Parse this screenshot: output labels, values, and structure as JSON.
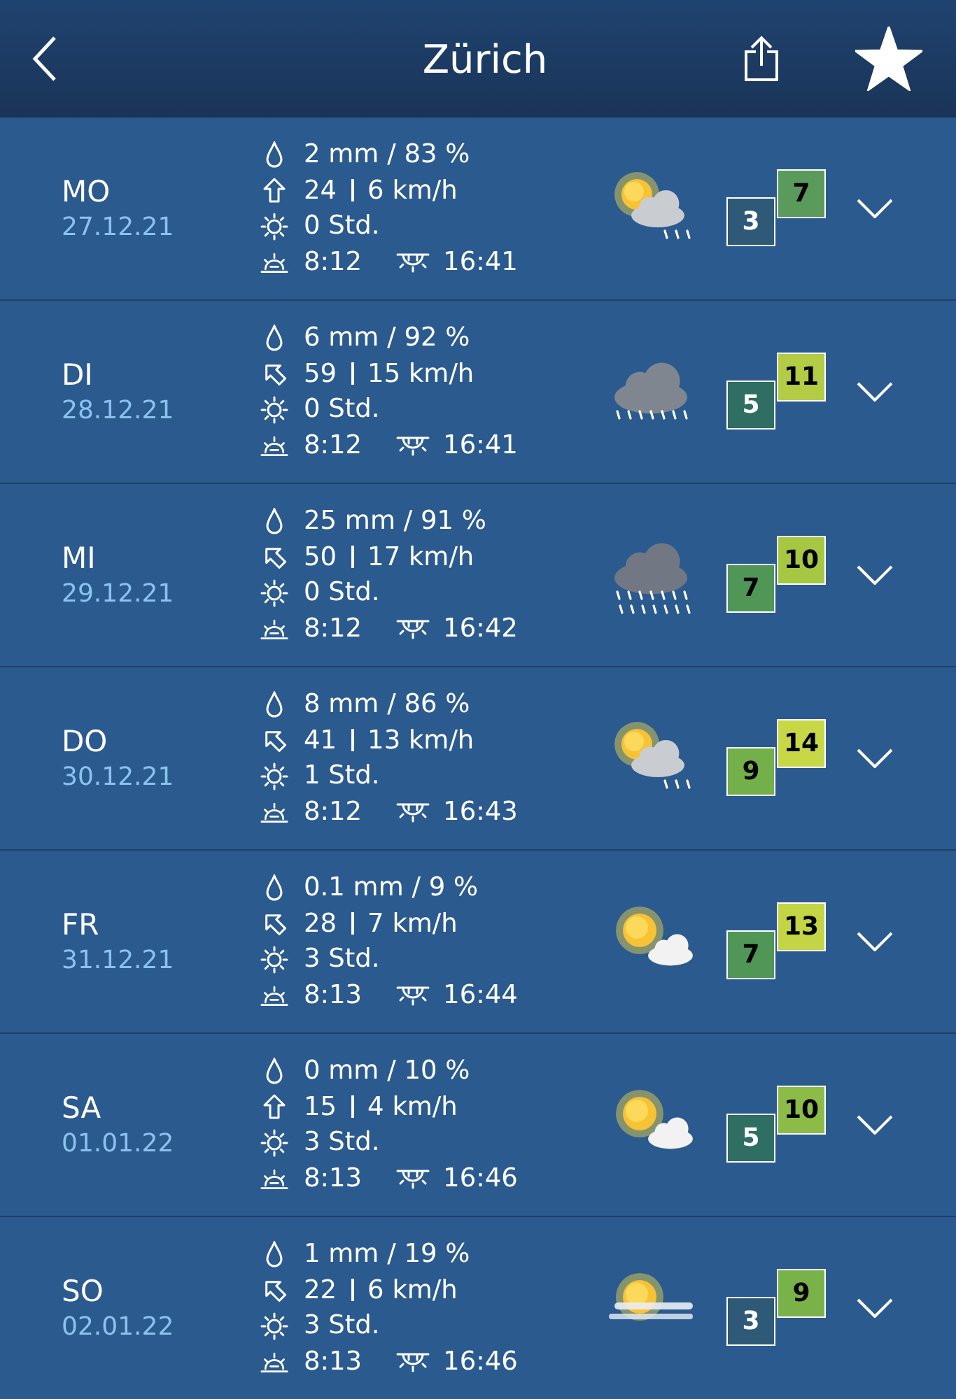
{
  "header": {
    "title": "Zürich",
    "favorite": true
  },
  "days": [
    {
      "day": "MO",
      "date": "27.12.21",
      "precipitation": "2 mm / 83 %",
      "wind": {
        "kind": "up",
        "a": "24",
        "b": "6 km/h"
      },
      "sunshine": "0 Std.",
      "sunrise": "8:12",
      "sunset": "16:41",
      "weather": {
        "kind": "sun_cloud_rain"
      },
      "temp_min": {
        "value": "3",
        "color": "#2e5a78"
      },
      "temp_max": {
        "value": "7",
        "color": "#5a9a5a"
      }
    },
    {
      "day": "DI",
      "date": "28.12.21",
      "precipitation": "6 mm / 92 %",
      "wind": {
        "kind": "up_left",
        "a": "59",
        "b": "15 km/h"
      },
      "sunshine": "0 Std.",
      "sunrise": "8:12",
      "sunset": "16:41",
      "weather": {
        "kind": "rain"
      },
      "temp_min": {
        "value": "5",
        "color": "#2f6e62"
      },
      "temp_max": {
        "value": "11",
        "color": "#b3cb45"
      }
    },
    {
      "day": "MI",
      "date": "29.12.21",
      "precipitation": "25 mm / 91 %",
      "wind": {
        "kind": "up_left",
        "a": "50",
        "b": "17 km/h"
      },
      "sunshine": "0 Std.",
      "sunrise": "8:12",
      "sunset": "16:42",
      "weather": {
        "kind": "heavy_rain"
      },
      "temp_min": {
        "value": "7",
        "color": "#4f9657"
      },
      "temp_max": {
        "value": "10",
        "color": "#a6c742"
      }
    },
    {
      "day": "DO",
      "date": "30.12.21",
      "precipitation": "8 mm / 86 %",
      "wind": {
        "kind": "up_left",
        "a": "41",
        "b": "13 km/h"
      },
      "sunshine": "1 Std.",
      "sunrise": "8:12",
      "sunset": "16:43",
      "weather": {
        "kind": "sun_cloud_rain"
      },
      "temp_min": {
        "value": "9",
        "color": "#73b04a"
      },
      "temp_max": {
        "value": "14",
        "color": "#c8d746"
      }
    },
    {
      "day": "FR",
      "date": "31.12.21",
      "precipitation": "0.1 mm / 9 %",
      "wind": {
        "kind": "up_left",
        "a": "28",
        "b": "7 km/h"
      },
      "sunshine": "3 Std.",
      "sunrise": "8:13",
      "sunset": "16:44",
      "weather": {
        "kind": "sun_cloud"
      },
      "temp_min": {
        "value": "7",
        "color": "#4f9657"
      },
      "temp_max": {
        "value": "13",
        "color": "#c3d445"
      }
    },
    {
      "day": "SA",
      "date": "01.01.22",
      "precipitation": "0 mm / 10 %",
      "wind": {
        "kind": "up",
        "a": "15",
        "b": "4 km/h"
      },
      "sunshine": "3 Std.",
      "sunrise": "8:13",
      "sunset": "16:46",
      "weather": {
        "kind": "sun_cloud"
      },
      "temp_min": {
        "value": "5",
        "color": "#2f6e62"
      },
      "temp_max": {
        "value": "10",
        "color": "#8cbc47"
      }
    },
    {
      "day": "SO",
      "date": "02.01.22",
      "precipitation": "1 mm / 19 %",
      "wind": {
        "kind": "up_left",
        "a": "22",
        "b": "6 km/h"
      },
      "sunshine": "3 Std.",
      "sunrise": "8:13",
      "sunset": "16:46",
      "weather": {
        "kind": "sun_fog"
      },
      "temp_min": {
        "value": "3",
        "color": "#2e5a78"
      },
      "temp_max": {
        "value": "9",
        "color": "#7ab24a"
      }
    }
  ]
}
